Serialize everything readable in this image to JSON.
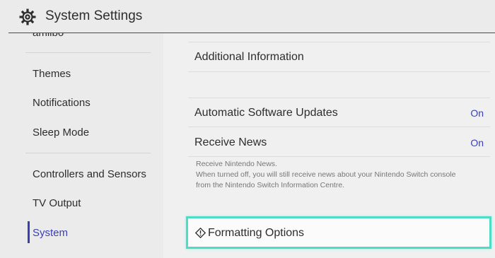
{
  "header": {
    "title": "System Settings",
    "icon": "gear-icon"
  },
  "sidebar": {
    "items": [
      {
        "label": "amiibo"
      },
      {
        "label": "Themes"
      },
      {
        "label": "Notifications"
      },
      {
        "label": "Sleep Mode"
      },
      {
        "label": "Controllers and Sensors"
      },
      {
        "label": "TV Output"
      },
      {
        "label": "System",
        "selected": true
      }
    ]
  },
  "main": {
    "additional_info": "Additional Information",
    "auto_updates": {
      "label": "Automatic Software Updates",
      "value": "On"
    },
    "receive_news": {
      "label": "Receive News",
      "value": "On",
      "description": [
        "Receive Nintendo News.",
        "When turned off, you will still receive news about your Nintendo Switch console",
        "from the Nintendo Switch Information Centre."
      ]
    },
    "formatting_options": "Formatting Options"
  },
  "colors": {
    "accent": "#3a3fb3",
    "focus": "#4fdcc6"
  }
}
